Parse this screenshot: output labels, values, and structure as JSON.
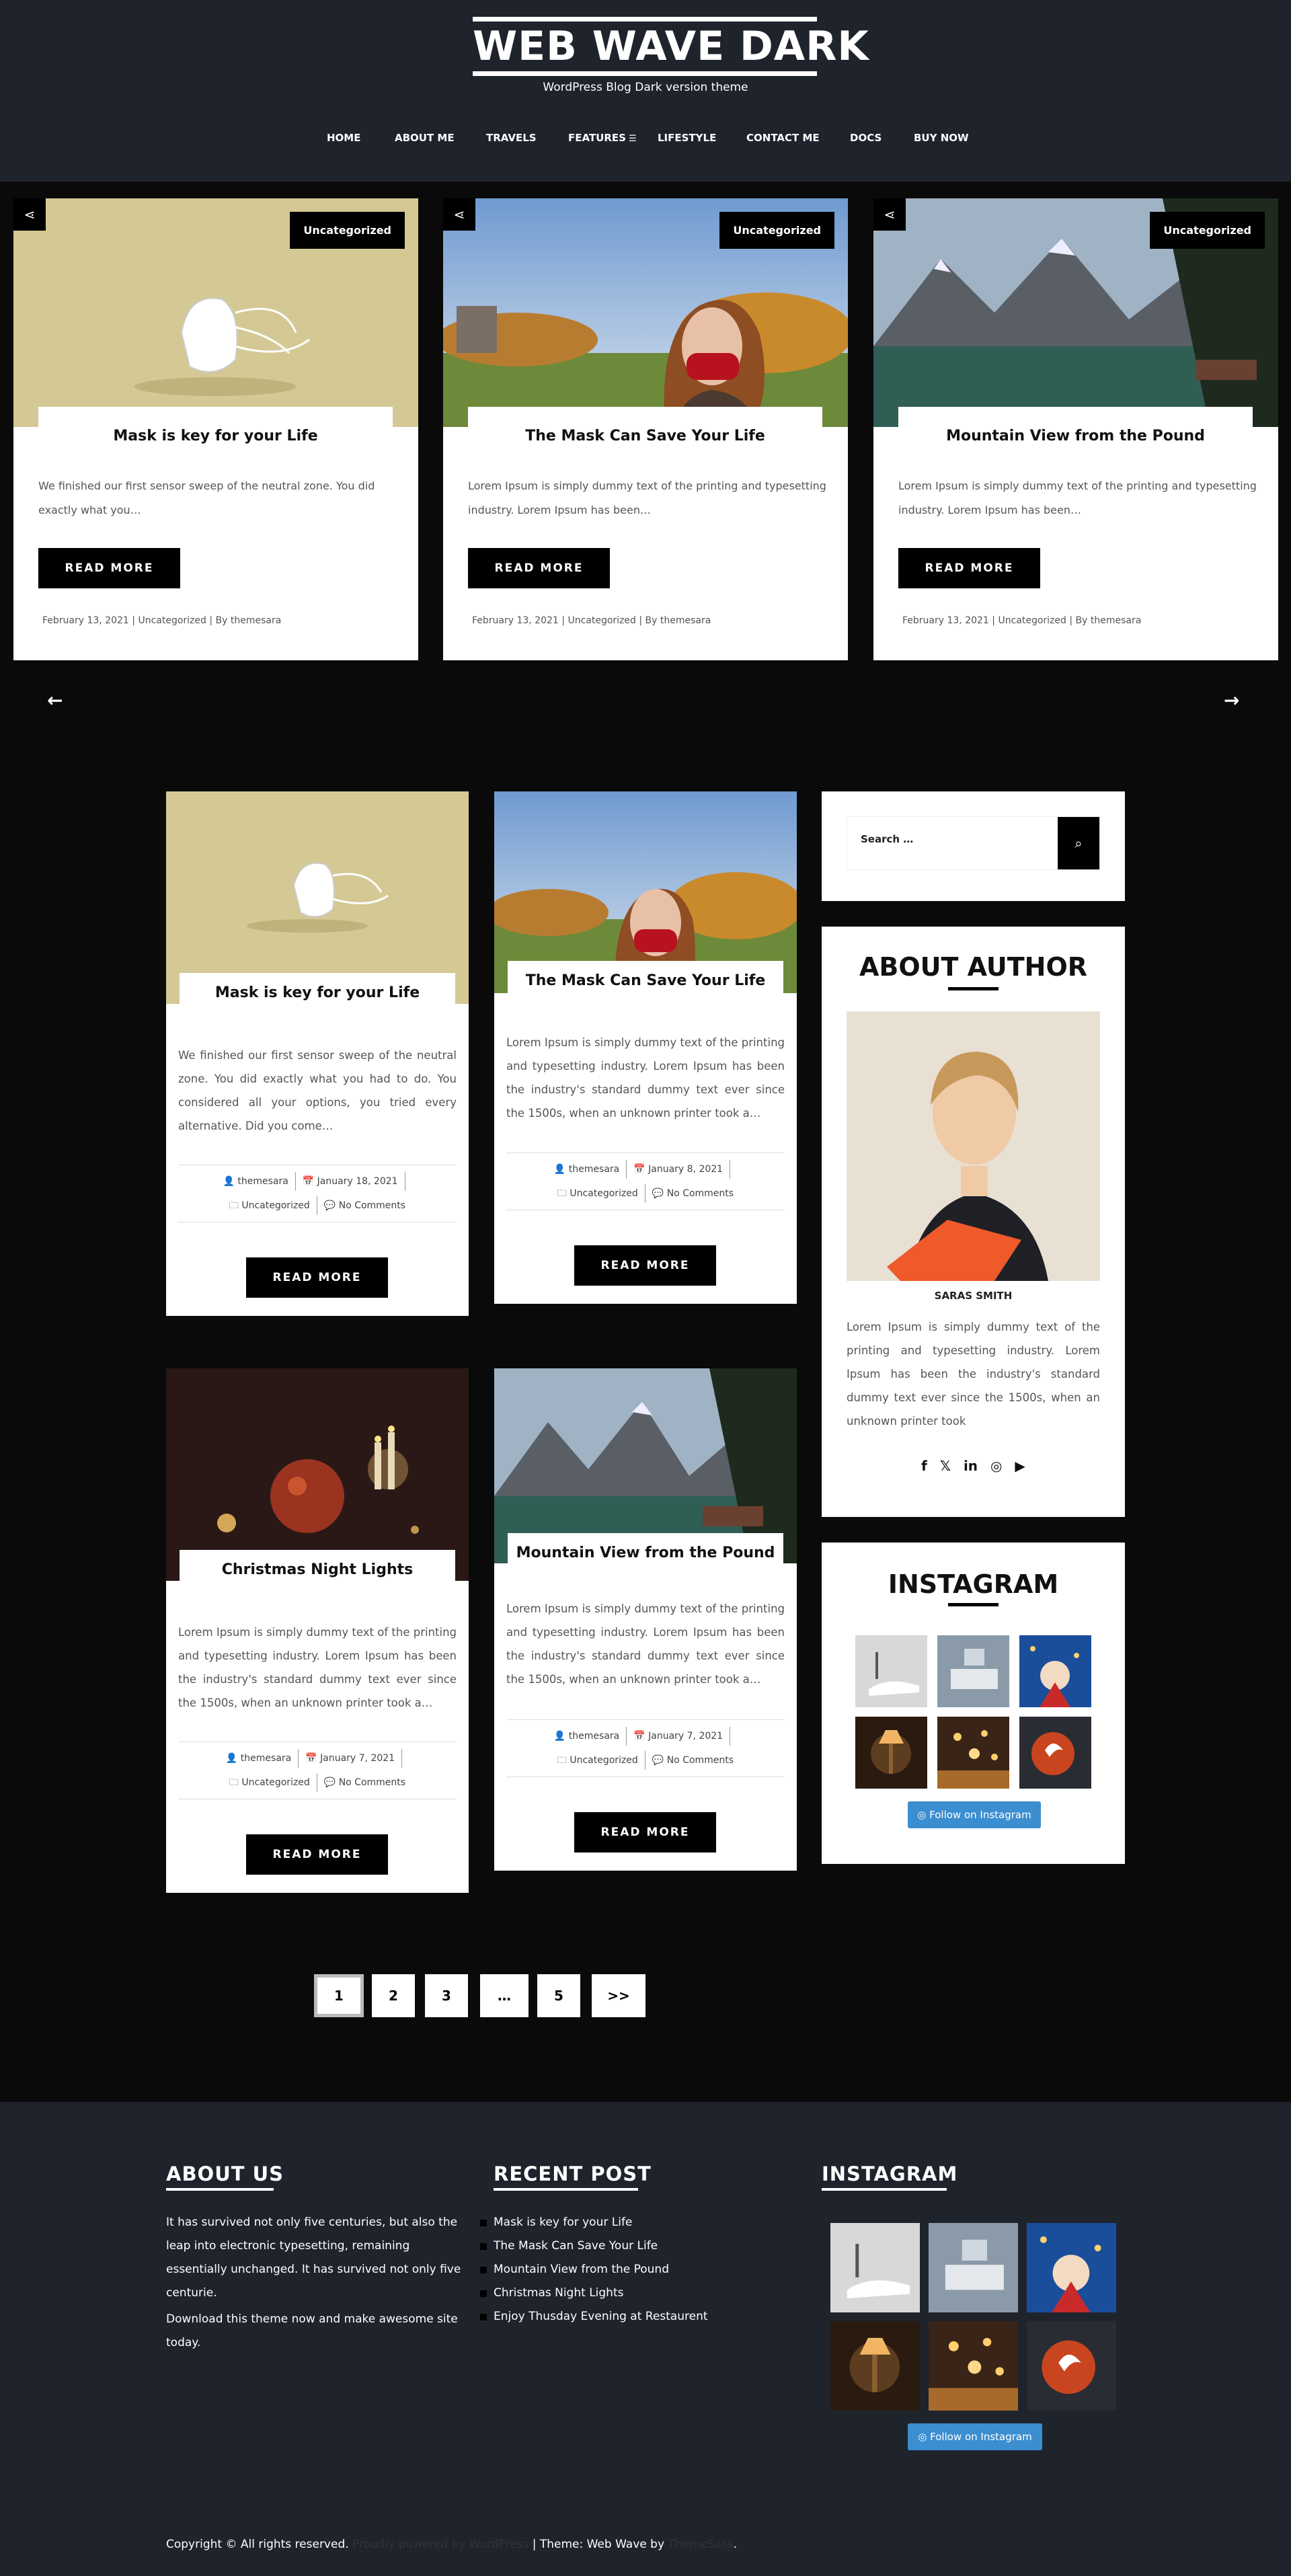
{
  "site": {
    "title": "WEB WAVE DARK",
    "tagline": "WordPress Blog Dark version theme"
  },
  "nav": {
    "items": [
      {
        "label": "HOME"
      },
      {
        "label": "ABOUT ME"
      },
      {
        "label": "TRAVELS"
      },
      {
        "label": "FEATURES"
      },
      {
        "label": "LIFESTYLE"
      },
      {
        "label": "CONTACT ME"
      },
      {
        "label": "DOCS"
      },
      {
        "label": "BUY NOW"
      }
    ],
    "features_icon": "menu-icon"
  },
  "slider": {
    "cards": [
      {
        "category": "Uncategorized",
        "title": "Mask is key for your Life",
        "excerpt": "We finished our first sensor sweep of the neutral zone. You did exactly what you…",
        "button": "READ MORE",
        "meta": "February 13, 2021 |    Uncategorized |    By themesara"
      },
      {
        "category": "Uncategorized",
        "title": "The Mask Can Save Your Life",
        "excerpt": "Lorem Ipsum is simply dummy text of the printing and typesetting industry. Lorem Ipsum has been…",
        "button": "READ MORE",
        "meta": "February 13, 2021 |    Uncategorized |    By themesara"
      },
      {
        "category": "Uncategorized",
        "title": "Mountain View from the Pound",
        "excerpt": "Lorem Ipsum is simply dummy text of the printing and typesetting industry. Lorem Ipsum has been…",
        "button": "READ MORE",
        "meta": "February 13, 2021 |    Uncategorized |    By themesara"
      }
    ],
    "prev_icon": "arrow-left-icon",
    "next_icon": "arrow-right-icon"
  },
  "posts": [
    {
      "title": "Mask is key for your Life",
      "excerpt": "We finished our first sensor sweep of the neutral zone. You did exactly what you had to do. You considered all your options, you tried every alternative. Did you come…",
      "author": "themesara",
      "date": "January 18, 2021",
      "category": "Uncategorized",
      "comments": "No Comments",
      "button": "READ MORE"
    },
    {
      "title": "The Mask Can Save Your Life",
      "excerpt": "Lorem Ipsum is simply dummy text of the printing and typesetting industry. Lorem Ipsum has been the industry's standard dummy text ever since the 1500s, when an unknown printer took a…",
      "author": "themesara",
      "date": "January 8, 2021",
      "category": "Uncategorized",
      "comments": "No Comments",
      "button": "READ MORE"
    },
    {
      "title": "Christmas Night Lights",
      "excerpt": "Lorem Ipsum is simply dummy text of the printing and typesetting industry. Lorem Ipsum has been the industry's standard dummy text ever since the 1500s, when an unknown printer took a…",
      "author": "themesara",
      "date": "January 7, 2021",
      "category": "Uncategorized",
      "comments": "No Comments",
      "button": "READ MORE"
    },
    {
      "title": "Mountain View from the Pound",
      "excerpt": "Lorem Ipsum is simply dummy text of the printing and typesetting industry. Lorem Ipsum has been the industry's standard dummy text ever since the 1500s, when an unknown printer took a…",
      "author": "themesara",
      "date": "January 7, 2021",
      "category": "Uncategorized",
      "comments": "No Comments",
      "button": "READ MORE"
    }
  ],
  "sidebar": {
    "search_placeholder": "Search …",
    "about_title": "ABOUT AUTHOR",
    "author_name": "SARAS SMITH",
    "author_bio": "Lorem Ipsum is simply dummy text of the printing and typesetting industry. Lorem Ipsum has been the industry's standard dummy text ever since the 1500s, when an unknown printer took",
    "social": {
      "facebook": "f",
      "twitter": "𝕏",
      "linkedin": "in",
      "instagram": "◎",
      "youtube": "▶"
    },
    "instagram_title": "INSTAGRAM",
    "follow_label": "Follow on Instagram"
  },
  "pagination": {
    "pages": [
      "1",
      "2",
      "3",
      "…",
      "5",
      ">>"
    ]
  },
  "footer": {
    "about_title": "ABOUT US",
    "about_text_1": "It has survived not only five centuries, but also the leap into electronic typesetting, remaining essentially unchanged. It has survived not only five centurie.",
    "about_text_2": "Download this theme now and make awesome site today.",
    "recent_title": "RECENT POST",
    "recent_posts": [
      "Mask is key for your Life",
      "The Mask Can Save Your Life",
      "Mountain View from the Pound",
      "Christmas Night Lights",
      "Enjoy Thusday Evening at Restaurent"
    ],
    "instagram_title": "INSTAGRAM",
    "follow_label": "Follow on Instagram",
    "copyright": "Copyright © All rights reserved.",
    "powered": "Proudly powered by WordPress",
    "theme_text": "| Theme: Web Wave by",
    "theme_author": "ThemeSara",
    "dot": "."
  },
  "colors": {
    "header_bg": "#1f232c",
    "page_bg": "#0a0a0a",
    "accent_button": "#000000",
    "instagram_button": "#3b8ed0"
  }
}
